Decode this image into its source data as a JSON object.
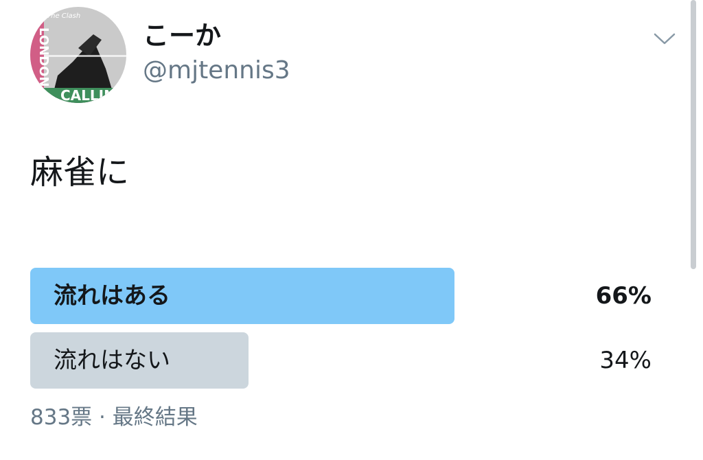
{
  "user": {
    "display_name": "こーか",
    "handle": "@mjtennis3",
    "avatar_icon": "album-cover-avatar",
    "avatar_text_top": "The Clash",
    "avatar_text_side": "LONDON",
    "avatar_text_bottom": "CALLING"
  },
  "menu": {
    "icon": "chevron-down-icon"
  },
  "tweet": {
    "text": "麻雀に"
  },
  "poll": {
    "options": [
      {
        "label": "流れはある",
        "percent_text": "66%",
        "percent": 66,
        "color": "#7fc8f8"
      },
      {
        "label": "流れはない",
        "percent_text": "34%",
        "percent": 34,
        "color": "#ccd6dd"
      }
    ],
    "footer": "833票 · 最終結果"
  },
  "colors": {
    "winner_bar": "#7fc8f8",
    "loser_bar": "#ccd6dd",
    "secondary_text": "#657786",
    "primary_text": "#14171a"
  }
}
